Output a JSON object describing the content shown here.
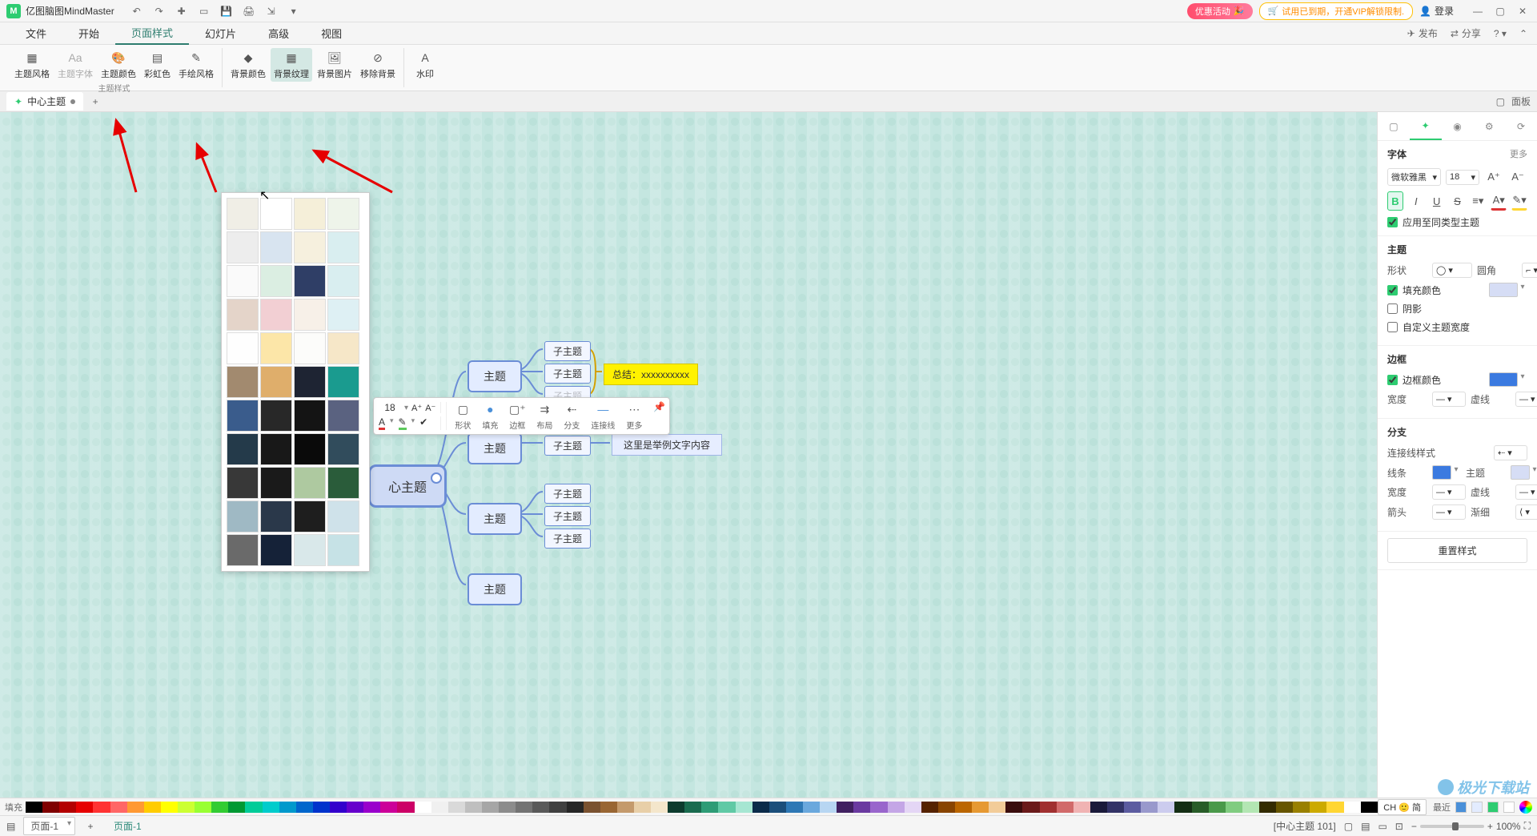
{
  "app": {
    "title": "亿图脑图MindMaster"
  },
  "titlebar": {
    "promo": "优惠活动",
    "vip": "试用已到期，开通VIP解锁限制.",
    "login": "登录"
  },
  "menu": {
    "items": [
      "文件",
      "开始",
      "页面样式",
      "幻灯片",
      "高级",
      "视图"
    ],
    "active": 2,
    "publish": "发布",
    "share": "分享"
  },
  "ribbon": {
    "group1_label": "主题样式",
    "btns1": [
      "主题风格",
      "主题字体",
      "主题颜色",
      "彩虹色",
      "手绘风格"
    ],
    "btns2": [
      "背景颜色",
      "背景纹理",
      "背景图片",
      "移除背景"
    ],
    "btns3": [
      "水印"
    ],
    "selected": "背景纹理"
  },
  "tabbar": {
    "doc": "中心主题",
    "panel": "面板"
  },
  "mindmap": {
    "root": "心主题",
    "mains": [
      "主题",
      "主题",
      "主题",
      "主题"
    ],
    "subs": [
      "子主题",
      "子主题",
      "子主题",
      "子主题",
      "子主题",
      "子主题",
      "子主题"
    ],
    "callout": "总结：xxxxxxxxxx",
    "example": "这里是举例文字内容"
  },
  "float_tb": {
    "font_size": "18",
    "items": [
      "形状",
      "填充",
      "边框",
      "布局",
      "分支",
      "连接线",
      "更多"
    ]
  },
  "right_panel": {
    "font_header": "字体",
    "more": "更多",
    "font_family": "微软雅黑",
    "font_size": "18",
    "apply_same": "应用至同类型主题",
    "theme_header": "主题",
    "shape": "形状",
    "corner": "圆角",
    "fill_color": "填充颜色",
    "shadow": "阴影",
    "custom_width": "自定义主题宽度",
    "border_header": "边框",
    "border_color": "边框颜色",
    "width": "宽度",
    "dash": "虚线",
    "branch_header": "分支",
    "conn_style": "连接线样式",
    "line": "线条",
    "theme2": "主题",
    "width2": "宽度",
    "dash2": "虚线",
    "arrow": "箭头",
    "taper": "渐细",
    "reset": "重置样式",
    "colors": {
      "fill": "#d6ddf5",
      "border": "#3b7ae0",
      "branch_line": "#3b7ae0",
      "branch_theme": "#d6ddf5"
    }
  },
  "colorbar": {
    "label": "填充",
    "recent": "最近",
    "ime": "CH 🙂 简"
  },
  "statusbar": {
    "page_dd": "页面-1",
    "page_tab": "页面-1",
    "node_info": "[中心主题 101]",
    "zoom": "100%"
  },
  "watermark": "极光下载站",
  "texture_colors": [
    "#f0eee6",
    "#ffffff",
    "#f5efd9",
    "#eef4ea",
    "#ededed",
    "#d8e4f0",
    "#f6f0de",
    "#d9eef0",
    "#fafafa",
    "#dbeee2",
    "#2f3e66",
    "#d9eef0",
    "#e4d4c9",
    "#f2cfd3",
    "#f7f0e8",
    "#def0f4",
    "#fefefe",
    "#fce6a8",
    "#fcfcfa",
    "#f6e7c8",
    "#a28a6f",
    "#dfae6b",
    "#1e2433",
    "#1a9b8f",
    "#3a5c8c",
    "#282828",
    "#141414",
    "#5a6280",
    "#243a4a",
    "#181818",
    "#0a0a0a",
    "#314c5c",
    "#383838",
    "#1a1a1a",
    "#aec9a0",
    "#2a5c3a",
    "#9fb9c4",
    "#2a384a",
    "#1e1e1e",
    "#cfe2ea",
    "#6a6a6a",
    "#152238",
    "#d9e8ea",
    "#c6e2e6"
  ],
  "colorbar_swatches": [
    "#000000",
    "#7f0000",
    "#b30000",
    "#e60000",
    "#ff3333",
    "#ff6666",
    "#ff9933",
    "#ffcc00",
    "#ffff00",
    "#ccff33",
    "#99ff33",
    "#33cc33",
    "#009933",
    "#00cc99",
    "#00cccc",
    "#0099cc",
    "#0066cc",
    "#0033cc",
    "#3300cc",
    "#6600cc",
    "#9900cc",
    "#cc0099",
    "#cc0066",
    "#ffffff",
    "#f0f0f0",
    "#d9d9d9",
    "#bfbfbf",
    "#a6a6a6",
    "#8c8c8c",
    "#737373",
    "#595959",
    "#404040",
    "#262626",
    "#7a5230",
    "#996633",
    "#c49a6c",
    "#e8cfa8",
    "#f4e6cb",
    "#0d3b2e",
    "#1a6b4f",
    "#2e9c76",
    "#60c9a5",
    "#a6e6d2",
    "#0b2b4a",
    "#1b4e7a",
    "#2e78b5",
    "#6aa8dd",
    "#b7d6f2",
    "#402060",
    "#6a3aa0",
    "#9966cc",
    "#c4a6e6",
    "#e4d6f5",
    "#552200",
    "#884400",
    "#bb6600",
    "#e69933",
    "#f2cc99",
    "#3a0d0d",
    "#6a1a1a",
    "#a03030",
    "#d16a6a",
    "#f0b3b3",
    "#1a1a3a",
    "#333366",
    "#5c5ca0",
    "#9999cc",
    "#ccccee",
    "#142e14",
    "#285c28",
    "#4a994a",
    "#80cc80",
    "#b3e6b3",
    "#332b00",
    "#665500",
    "#998000",
    "#ccaa00",
    "#ffd633",
    "#ffffff",
    "#000000"
  ]
}
